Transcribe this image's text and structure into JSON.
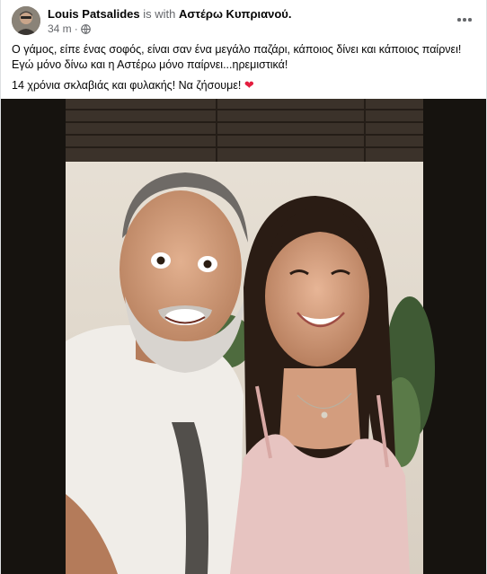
{
  "post": {
    "author": "Louis Patsalides",
    "with_text": "is with",
    "tagged_name": "Αστέρω Κυπριανού.",
    "timestamp": "34 m",
    "separator": "·",
    "privacy_icon": "globe-icon",
    "more_icon": "more-options-icon",
    "text_line_1": "Ο γάμος, είπε ένας σοφός, είναι σαν ένα μεγάλο παζάρι, κάποιος δίνει και κάποιος παίρνει!  Εγώ μόνο δίνω και η Αστέρω μόνο παίρνει...ηρεμιστικά!",
    "text_line_2": "14 χρόνια σκλαβιάς και φυλακής!  Να ζήσουμε!",
    "heart_emoji": "❤",
    "photo_description_icon": "photo"
  },
  "colors": {
    "text_primary": "#050505",
    "text_secondary": "#65676b",
    "heart": "#e41e3f"
  }
}
